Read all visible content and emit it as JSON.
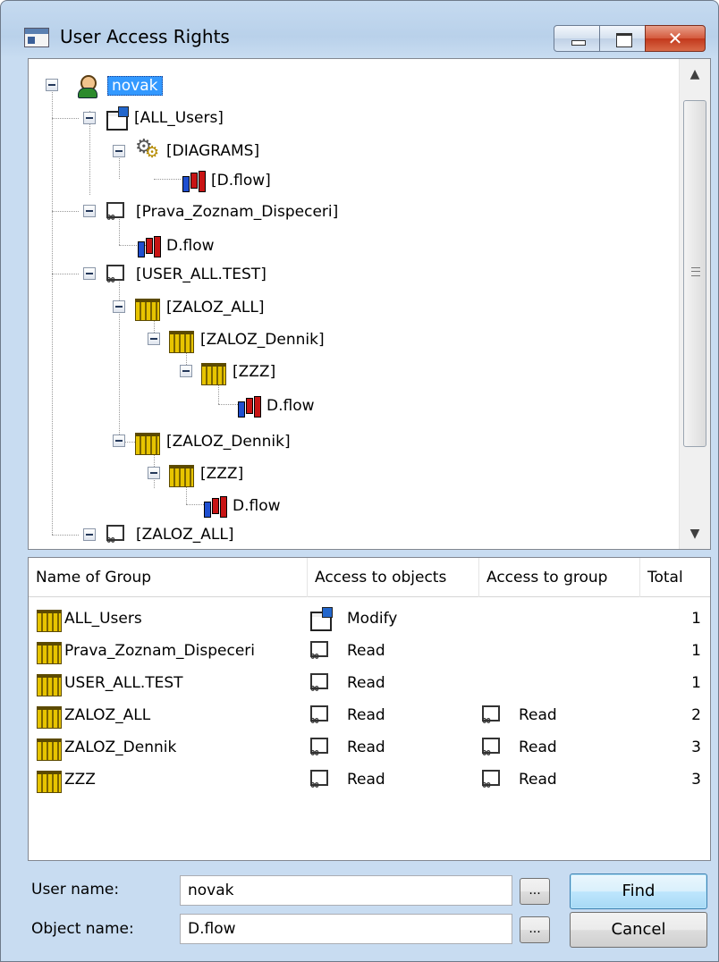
{
  "window": {
    "title": "User Access Rights"
  },
  "tree": {
    "nodes": [
      {
        "label": "novak",
        "icon": "user-icon",
        "selected": true
      },
      {
        "label": "[ALL_Users]",
        "icon": "modify-doc-icon"
      },
      {
        "label": "[DIAGRAMS]",
        "icon": "gears-icon"
      },
      {
        "label": "[D.flow]",
        "icon": "chart-icon"
      },
      {
        "label": "[Prava_Zoznam_Dispeceri]",
        "icon": "network-icon"
      },
      {
        "label": "D.flow",
        "icon": "chart-icon"
      },
      {
        "label": "[USER_ALL.TEST]",
        "icon": "network-icon"
      },
      {
        "label": "[ZALOZ_ALL]",
        "icon": "folder-icon"
      },
      {
        "label": "[ZALOZ_Dennik]",
        "icon": "folder-icon"
      },
      {
        "label": "[ZZZ]",
        "icon": "folder-icon"
      },
      {
        "label": "D.flow",
        "icon": "chart-icon"
      },
      {
        "label": "[ZALOZ_Dennik]",
        "icon": "folder-icon"
      },
      {
        "label": "[ZZZ]",
        "icon": "folder-icon"
      },
      {
        "label": "D.flow",
        "icon": "chart-icon"
      },
      {
        "label": "[ZALOZ_ALL]",
        "icon": "network-icon"
      }
    ]
  },
  "list": {
    "columns": [
      "Name of Group",
      "Access to objects",
      "Access to group",
      "Total"
    ],
    "rows": [
      {
        "name": "ALL_Users",
        "objects": "Modify",
        "group": "",
        "total": "1"
      },
      {
        "name": "Prava_Zoznam_Dispeceri",
        "objects": "Read",
        "group": "",
        "total": "1"
      },
      {
        "name": "USER_ALL.TEST",
        "objects": "Read",
        "group": "",
        "total": "1"
      },
      {
        "name": "ZALOZ_ALL",
        "objects": "Read",
        "group": "Read",
        "total": "2"
      },
      {
        "name": "ZALOZ_Dennik",
        "objects": "Read",
        "group": "Read",
        "total": "3"
      },
      {
        "name": "ZZZ",
        "objects": "Read",
        "group": "Read",
        "total": "3"
      }
    ]
  },
  "form": {
    "user_label": "User name:",
    "user_value": "novak",
    "object_label": "Object name:",
    "object_value": "D.flow",
    "browse_label": "...",
    "find_label": "Find",
    "cancel_label": "Cancel"
  }
}
